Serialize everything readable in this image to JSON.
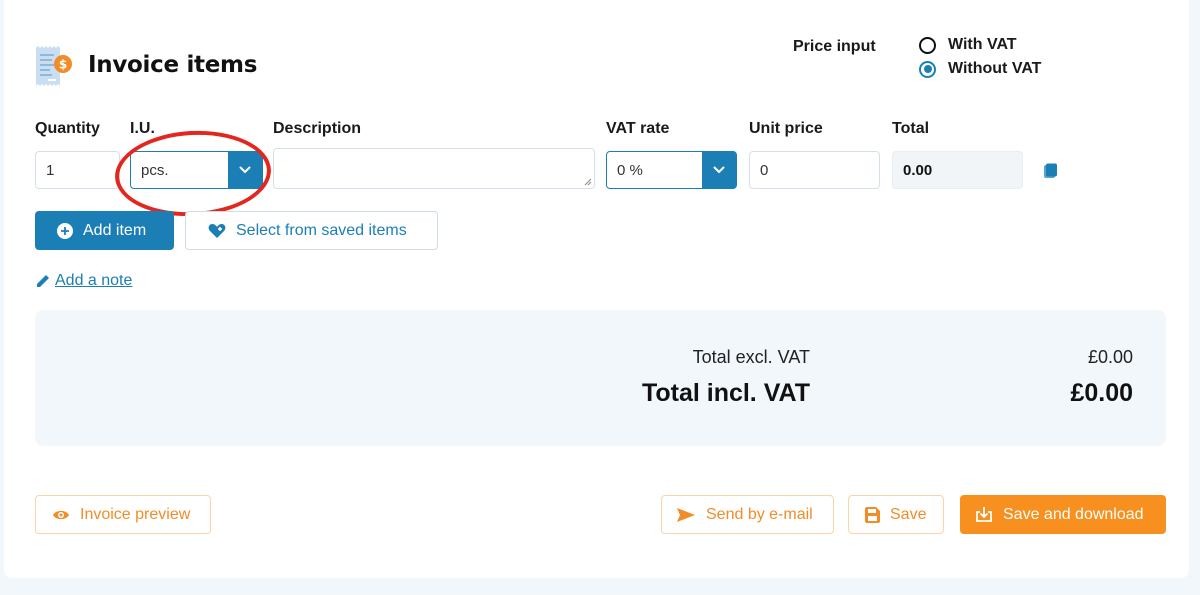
{
  "header": {
    "title": "Invoice items",
    "title_icon": "invoice-receipt-icon"
  },
  "price_input": {
    "label": "Price input",
    "options": [
      {
        "label": "With VAT",
        "checked": false
      },
      {
        "label": "Without VAT",
        "checked": true
      }
    ]
  },
  "columns": {
    "quantity": "Quantity",
    "unit": "I.U.",
    "description": "Description",
    "vat_rate": "VAT rate",
    "unit_price": "Unit price",
    "total": "Total"
  },
  "item_row": {
    "quantity": "1",
    "unit": "pcs.",
    "description": "",
    "vat_rate": "0 %",
    "unit_price": "0",
    "total": "0.00",
    "delete_icon": "trash-icon"
  },
  "actions": {
    "add_item": "Add item",
    "select_saved": "Select from saved items",
    "add_note": "Add a note"
  },
  "summary": {
    "total_excl_label": "Total excl. VAT",
    "total_excl_value": "£0.00",
    "total_incl_label": "Total incl. VAT",
    "total_incl_value": "£0.00"
  },
  "footer": {
    "preview": "Invoice preview",
    "send_email": "Send by e-mail",
    "save": "Save",
    "save_download": "Save and download"
  },
  "colors": {
    "primary_blue": "#1b7fb5",
    "accent_orange": "#f7901e",
    "annotation_red": "#e3261e",
    "summary_bg": "#f2f7fb"
  }
}
